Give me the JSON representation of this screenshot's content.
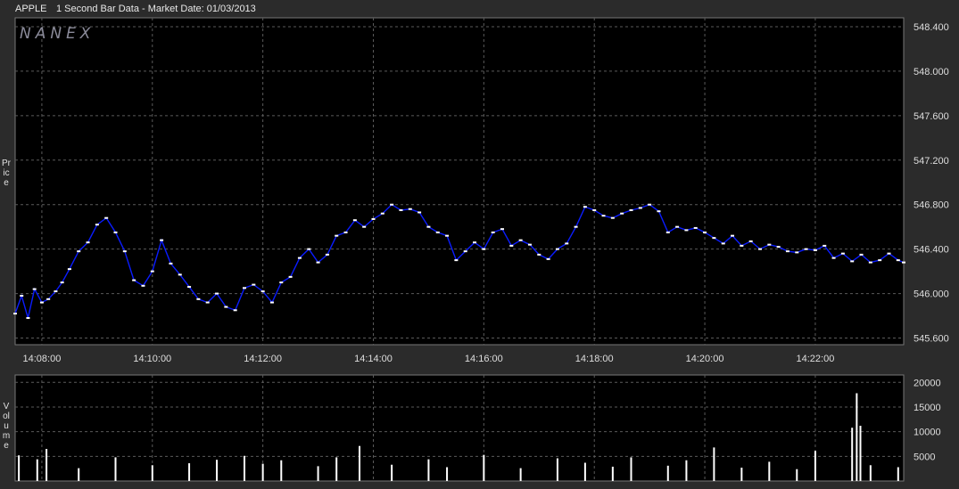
{
  "header": {
    "symbol": "APPLE",
    "subtitle": "1 Second Bar Data - Market Date: 01/03/2013"
  },
  "watermark": "NANEX",
  "colors": {
    "background": "#000000",
    "frame": "#2b2b2b",
    "price_line": "#0a1cff",
    "close_marker": "#ffffff",
    "volume_bars": "#ffffff",
    "grid": "#5a5a5a"
  },
  "chart_data": [
    {
      "type": "line",
      "title": "1 Second Bar Data - Market Date: 01/03/2013",
      "ylabel": "Price",
      "xlabel": "",
      "grid": true,
      "y_axis_side": "right",
      "x_ticks": [
        "14:08:00",
        "14:10:00",
        "14:12:00",
        "14:14:00",
        "14:16:00",
        "14:18:00",
        "14:20:00",
        "14:22:00"
      ],
      "y_ticks": [
        "545.600",
        "546.000",
        "546.400",
        "546.800",
        "547.200",
        "547.600",
        "548.000",
        "548.400"
      ],
      "xlim": [
        "14:07:31",
        "14:23:36"
      ],
      "ylim": [
        545.54,
        548.48
      ],
      "series": [
        {
          "name": "",
          "x": [
            "14:07:31",
            "14:07:38",
            "14:07:45",
            "14:07:52",
            "14:08:00",
            "14:08:07",
            "14:08:15",
            "14:08:22",
            "14:08:30",
            "14:08:40",
            "14:08:50",
            "14:09:00",
            "14:09:10",
            "14:09:20",
            "14:09:30",
            "14:09:40",
            "14:09:50",
            "14:10:00",
            "14:10:10",
            "14:10:20",
            "14:10:30",
            "14:10:40",
            "14:10:50",
            "14:11:00",
            "14:11:10",
            "14:11:20",
            "14:11:30",
            "14:11:40",
            "14:11:50",
            "14:12:00",
            "14:12:10",
            "14:12:20",
            "14:12:30",
            "14:12:40",
            "14:12:50",
            "14:13:00",
            "14:13:10",
            "14:13:20",
            "14:13:30",
            "14:13:40",
            "14:13:50",
            "14:14:00",
            "14:14:10",
            "14:14:20",
            "14:14:30",
            "14:14:40",
            "14:14:50",
            "14:15:00",
            "14:15:10",
            "14:15:20",
            "14:15:30",
            "14:15:40",
            "14:15:50",
            "14:16:00",
            "14:16:10",
            "14:16:20",
            "14:16:30",
            "14:16:40",
            "14:16:50",
            "14:17:00",
            "14:17:10",
            "14:17:20",
            "14:17:30",
            "14:17:40",
            "14:17:50",
            "14:18:00",
            "14:18:10",
            "14:18:20",
            "14:18:30",
            "14:18:40",
            "14:18:50",
            "14:19:00",
            "14:19:10",
            "14:19:20",
            "14:19:30",
            "14:19:40",
            "14:19:50",
            "14:20:00",
            "14:20:10",
            "14:20:20",
            "14:20:30",
            "14:20:40",
            "14:20:50",
            "14:21:00",
            "14:21:10",
            "14:21:20",
            "14:21:30",
            "14:21:40",
            "14:21:50",
            "14:22:00",
            "14:22:10",
            "14:22:20",
            "14:22:30",
            "14:22:40",
            "14:22:50",
            "14:23:00",
            "14:23:10",
            "14:23:20",
            "14:23:30",
            "14:23:36"
          ],
          "values": [
            545.82,
            545.98,
            545.78,
            546.04,
            545.92,
            545.95,
            546.02,
            546.1,
            546.22,
            546.38,
            546.46,
            546.62,
            546.68,
            546.55,
            546.38,
            546.12,
            546.07,
            546.2,
            546.48,
            546.27,
            546.17,
            546.06,
            545.95,
            545.92,
            546.0,
            545.88,
            545.85,
            546.05,
            546.08,
            546.02,
            545.92,
            546.1,
            546.15,
            546.32,
            546.4,
            546.28,
            546.35,
            546.52,
            546.55,
            546.66,
            546.6,
            546.67,
            546.72,
            546.8,
            546.75,
            546.76,
            546.73,
            546.6,
            546.55,
            546.52,
            546.3,
            546.38,
            546.46,
            546.4,
            546.55,
            546.58,
            546.43,
            546.48,
            546.44,
            546.35,
            546.31,
            546.4,
            546.45,
            546.6,
            546.78,
            546.75,
            546.7,
            546.68,
            546.72,
            546.75,
            546.77,
            546.8,
            546.74,
            546.55,
            546.6,
            546.57,
            546.59,
            546.55,
            546.5,
            546.45,
            546.52,
            546.43,
            546.47,
            546.4,
            546.44,
            546.42,
            546.38,
            546.37,
            546.4,
            546.39,
            546.43,
            546.32,
            546.36,
            546.29,
            546.35,
            546.28,
            546.3,
            546.36,
            546.3,
            546.28
          ]
        }
      ]
    },
    {
      "type": "bar",
      "ylabel": "Volume",
      "xlabel": "",
      "grid": true,
      "y_axis_side": "right",
      "y_ticks": [
        "5000",
        "10000",
        "15000",
        "20000"
      ],
      "ylim": [
        0,
        21500
      ],
      "series": [
        {
          "name": "",
          "x": [
            "14:07:35",
            "14:07:55",
            "14:08:05",
            "14:08:40",
            "14:09:20",
            "14:10:00",
            "14:10:40",
            "14:11:10",
            "14:11:40",
            "14:12:00",
            "14:12:20",
            "14:13:00",
            "14:13:20",
            "14:13:45",
            "14:14:20",
            "14:15:00",
            "14:15:20",
            "14:16:00",
            "14:16:40",
            "14:17:20",
            "14:17:50",
            "14:18:20",
            "14:18:40",
            "14:19:20",
            "14:19:40",
            "14:20:10",
            "14:20:40",
            "14:21:10",
            "14:21:40",
            "14:22:00",
            "14:22:40",
            "14:22:45",
            "14:22:49",
            "14:23:00",
            "14:23:30"
          ],
          "values": [
            5200,
            4400,
            6500,
            2600,
            4800,
            3200,
            3600,
            4300,
            5100,
            3500,
            4200,
            3000,
            4800,
            7100,
            3300,
            4400,
            2800,
            5300,
            2600,
            4600,
            3700,
            2900,
            4800,
            3100,
            4200,
            6800,
            2700,
            3900,
            2400,
            6100,
            10800,
            17800,
            11200,
            3200,
            2800
          ]
        }
      ]
    }
  ]
}
